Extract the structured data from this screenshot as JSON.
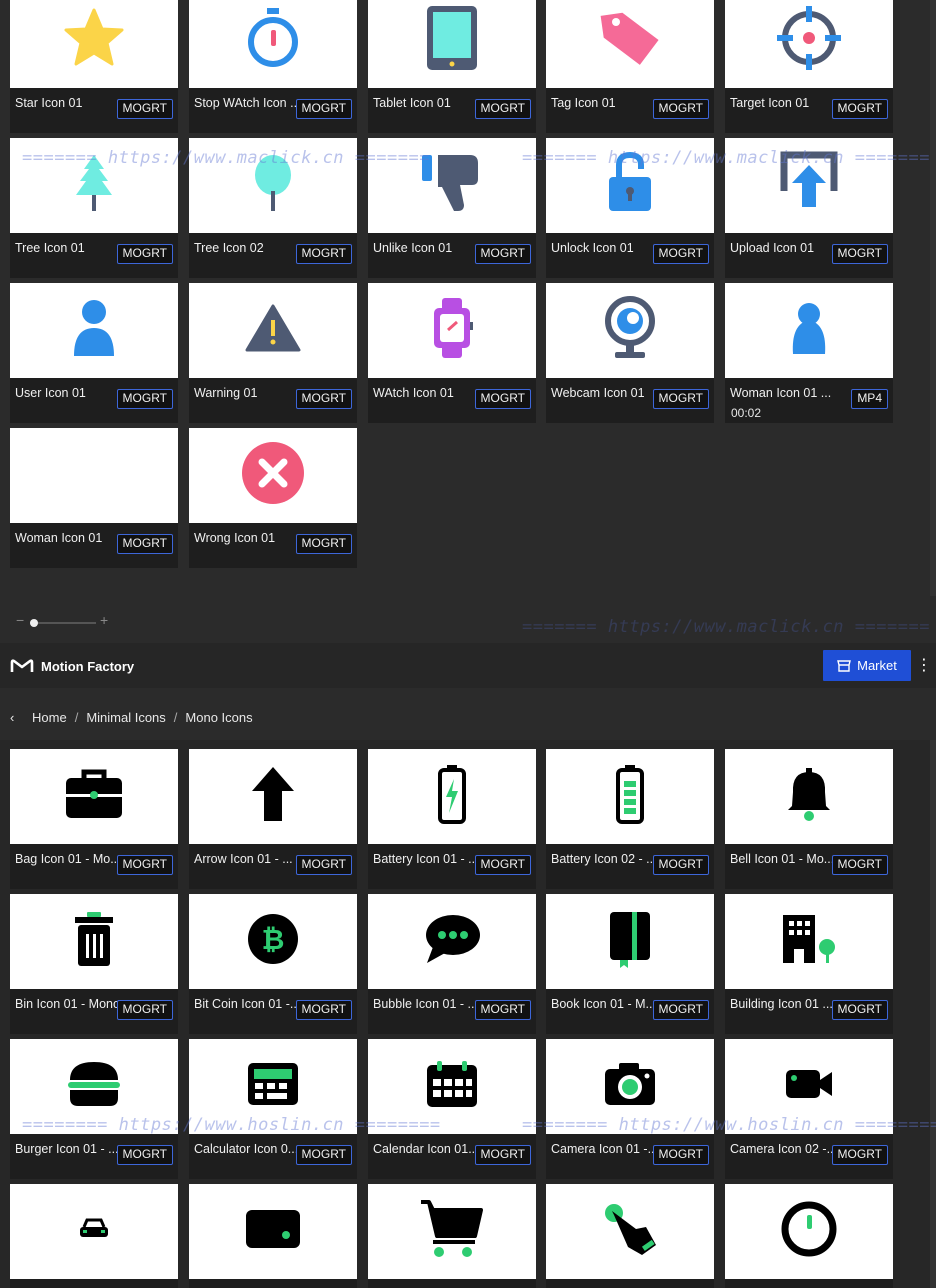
{
  "top_grid": {
    "cards": [
      {
        "title": "Star Icon 01",
        "badge": "MOGRT",
        "icon": "star-icon"
      },
      {
        "title": "Stop WAtch Icon ...",
        "badge": "MOGRT",
        "icon": "stopwatch-icon"
      },
      {
        "title": "Tablet Icon 01",
        "badge": "MOGRT",
        "icon": "tablet-icon"
      },
      {
        "title": "Tag Icon 01",
        "badge": "MOGRT",
        "icon": "tag-icon"
      },
      {
        "title": "Target Icon 01",
        "badge": "MOGRT",
        "icon": "target-icon"
      },
      {
        "title": "Tree Icon 01",
        "badge": "MOGRT",
        "icon": "tree-icon"
      },
      {
        "title": "Tree Icon 02",
        "badge": "MOGRT",
        "icon": "round-tree-icon"
      },
      {
        "title": "Unlike Icon 01",
        "badge": "MOGRT",
        "icon": "thumbs-down-icon"
      },
      {
        "title": "Unlock Icon 01",
        "badge": "MOGRT",
        "icon": "unlock-icon"
      },
      {
        "title": "Upload Icon 01",
        "badge": "MOGRT",
        "icon": "upload-icon"
      },
      {
        "title": "User Icon 01",
        "badge": "MOGRT",
        "icon": "user-icon"
      },
      {
        "title": "Warning 01",
        "badge": "MOGRT",
        "icon": "warning-icon"
      },
      {
        "title": "WAtch Icon 01",
        "badge": "MOGRT",
        "icon": "smartwatch-icon"
      },
      {
        "title": "Webcam Icon 01",
        "badge": "MOGRT",
        "icon": "webcam-icon"
      },
      {
        "title": "Woman Icon 01 ...",
        "badge": "MP4",
        "duration": "00:02",
        "icon": "woman-icon"
      },
      {
        "title": "Woman Icon 01",
        "badge": "MOGRT",
        "icon": "blank-thumbnail"
      },
      {
        "title": "Wrong Icon 01",
        "badge": "MOGRT",
        "icon": "wrong-icon"
      }
    ]
  },
  "header": {
    "app_title": "Motion Factory",
    "market_label": "Market",
    "more_glyph": "⋮"
  },
  "zoom": {
    "minus": "−",
    "plus": "+"
  },
  "breadcrumb": {
    "back_glyph": "‹",
    "items": [
      "Home",
      "Minimal Icons",
      "Mono Icons"
    ],
    "separator": "/"
  },
  "bottom_grid": {
    "cards": [
      {
        "title": "Bag Icon 01 - Mo...",
        "badge": "MOGRT",
        "icon": "briefcase-icon"
      },
      {
        "title": "Arrow Icon 01 - ...",
        "badge": "MOGRT",
        "icon": "arrow-up-icon"
      },
      {
        "title": "Battery Icon 01 - ...",
        "badge": "MOGRT",
        "icon": "battery-charging-icon"
      },
      {
        "title": "Battery Icon 02 - ...",
        "badge": "MOGRT",
        "icon": "battery-icon"
      },
      {
        "title": "Bell Icon 01 - Mo...",
        "badge": "MOGRT",
        "icon": "bell-icon"
      },
      {
        "title": "Bin Icon 01 - Mono",
        "badge": "MOGRT",
        "icon": "bin-icon"
      },
      {
        "title": "Bit Coin Icon 01 -...",
        "badge": "MOGRT",
        "icon": "bitcoin-icon"
      },
      {
        "title": "Bubble Icon 01 - ...",
        "badge": "MOGRT",
        "icon": "chat-bubble-icon"
      },
      {
        "title": "Book Icon 01 - M...",
        "badge": "MOGRT",
        "icon": "book-icon"
      },
      {
        "title": "Building Icon 01 ...",
        "badge": "MOGRT",
        "icon": "building-icon"
      },
      {
        "title": "Burger Icon 01 - ...",
        "badge": "MOGRT",
        "icon": "burger-icon"
      },
      {
        "title": "Calculator Icon 0...",
        "badge": "MOGRT",
        "icon": "calculator-icon"
      },
      {
        "title": "Calendar Icon 01...",
        "badge": "MOGRT",
        "icon": "calendar-icon"
      },
      {
        "title": "Camera Icon 01 -...",
        "badge": "MOGRT",
        "icon": "camera-icon"
      },
      {
        "title": "Camera Icon 02 -...",
        "badge": "MOGRT",
        "icon": "video-camera-icon"
      },
      {
        "title": "",
        "badge": "",
        "icon": "car-icon"
      },
      {
        "title": "",
        "badge": "",
        "icon": "card-icon"
      },
      {
        "title": "",
        "badge": "",
        "icon": "cart-icon"
      },
      {
        "title": "",
        "badge": "",
        "icon": "tap-icon"
      },
      {
        "title": "",
        "badge": "",
        "icon": "clock-icon"
      }
    ]
  },
  "watermarks": {
    "maclick": "======= https://www.maclick.cn =======",
    "hoslin": "======== https://www.hoslin.cn ========"
  },
  "colors": {
    "badge_border": "#3d66d9",
    "market_button": "#1f4fd6",
    "mono_accent": "#2ecc71"
  }
}
